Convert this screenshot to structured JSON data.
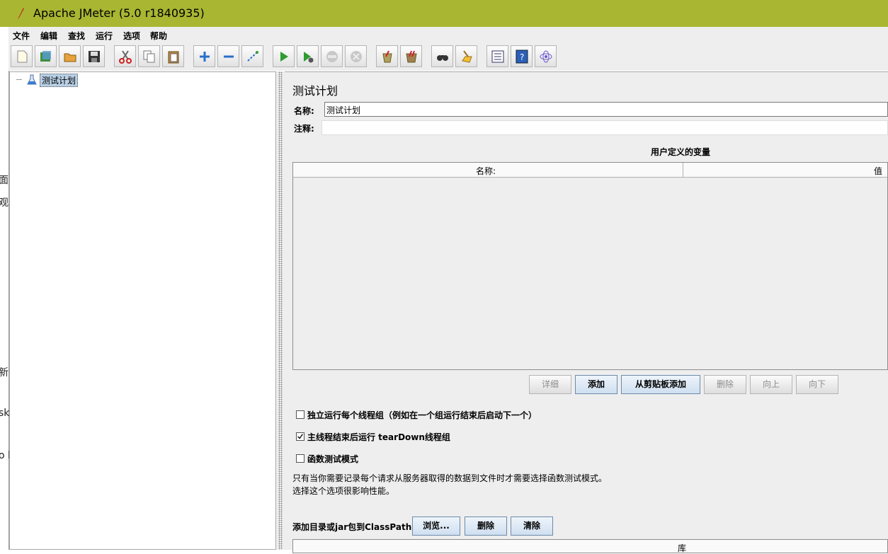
{
  "window": {
    "title": "Apache JMeter (5.0 r1840935)"
  },
  "left_strip_fragments": [
    "面目",
    "观",
    "新",
    "sk",
    "o l"
  ],
  "menu": [
    "文件",
    "编辑",
    "查找",
    "运行",
    "选项",
    "帮助"
  ],
  "toolbar_icons": [
    "new-icon",
    "templates-icon",
    "open-icon",
    "save-icon",
    "cut-icon",
    "copy-icon",
    "paste-icon",
    "expand-icon",
    "collapse-icon",
    "toggle-icon",
    "start-icon",
    "start-no-pause-icon",
    "stop-icon",
    "shutdown-icon",
    "clear-icon",
    "clear-all-icon",
    "search-icon",
    "reset-search-icon",
    "function-helper-icon",
    "help-icon",
    "remote-icon"
  ],
  "tree": {
    "root_label": "测试计划"
  },
  "panel": {
    "title": "测试计划",
    "name_label": "名称:",
    "name_value": "测试计划",
    "comment_label": "注释:",
    "comment_value": "",
    "variables_title": "用户定义的变量",
    "columns": [
      "名称:",
      "值"
    ],
    "buttons": {
      "detail": "详细",
      "add": "添加",
      "add_clipboard": "从剪贴板添加",
      "delete": "删除",
      "up": "向上",
      "down": "向下"
    },
    "checks": [
      {
        "label": "独立运行每个线程组（例如在一个组运行结束后启动下一个）",
        "checked": false
      },
      {
        "label": "主线程结束后运行 tearDown线程组",
        "checked": true
      },
      {
        "label": "函数测试模式",
        "checked": false
      }
    ],
    "note_line1": "只有当你需要记录每个请求从服务器取得的数据到文件时才需要选择函数测试模式。",
    "note_line2": "选择这个选项很影响性能。",
    "classpath_label": "添加目录或jar包到ClassPath",
    "classpath_buttons": {
      "browse": "浏览...",
      "delete": "删除",
      "clear": "清除"
    },
    "library_header": "库"
  }
}
